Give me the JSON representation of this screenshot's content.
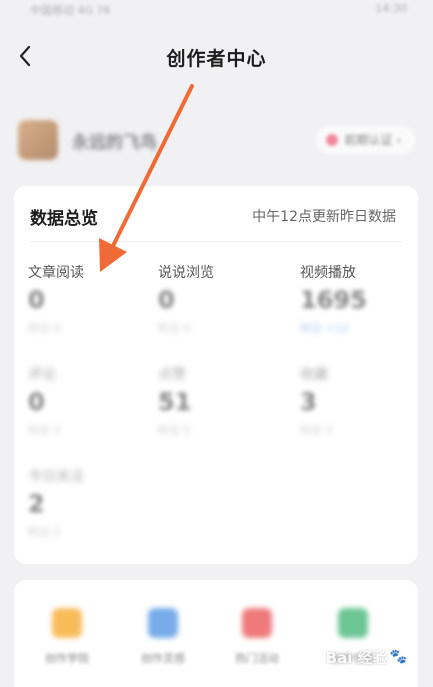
{
  "status_bar": {
    "left": "中国移动 4G 76",
    "right": "14:30"
  },
  "header": {
    "title": "创作者中心",
    "back_icon": "chevron-left-icon"
  },
  "profile": {
    "nickname": "永远的飞鸟",
    "badge": "前期认证 ›"
  },
  "data_overview": {
    "title": "数据总览",
    "update_note": "中午12点更新昨日数据",
    "metrics": [
      {
        "label": "文章阅读",
        "value": "0",
        "sub": "昨日 0"
      },
      {
        "label": "说说浏览",
        "value": "0",
        "sub": "昨日 0"
      },
      {
        "label": "视频播放",
        "value": "1695",
        "sub": "昨日 +12"
      },
      {
        "label": "评论",
        "value": "0",
        "sub": "昨日 0"
      },
      {
        "label": "点赞",
        "value": "51",
        "sub": "昨日 0"
      },
      {
        "label": "收藏",
        "value": "3",
        "sub": "昨日 0"
      },
      {
        "label": "今日关注",
        "value": "2",
        "sub": "昨日 0"
      }
    ]
  },
  "tools": [
    {
      "label": "创作学院",
      "color": "#f5a623"
    },
    {
      "label": "创作灵感",
      "color": "#4a90e2"
    },
    {
      "label": "热门活动",
      "color": "#e94e4e"
    },
    {
      "label": "创作任务",
      "color": "#3cb371"
    }
  ],
  "watermark": {
    "text": "Bai 经验",
    "paw": "🐾"
  },
  "colors": {
    "arrow": "#f06a35",
    "accent": "#4a90e2",
    "background": "#f1f1f3"
  }
}
